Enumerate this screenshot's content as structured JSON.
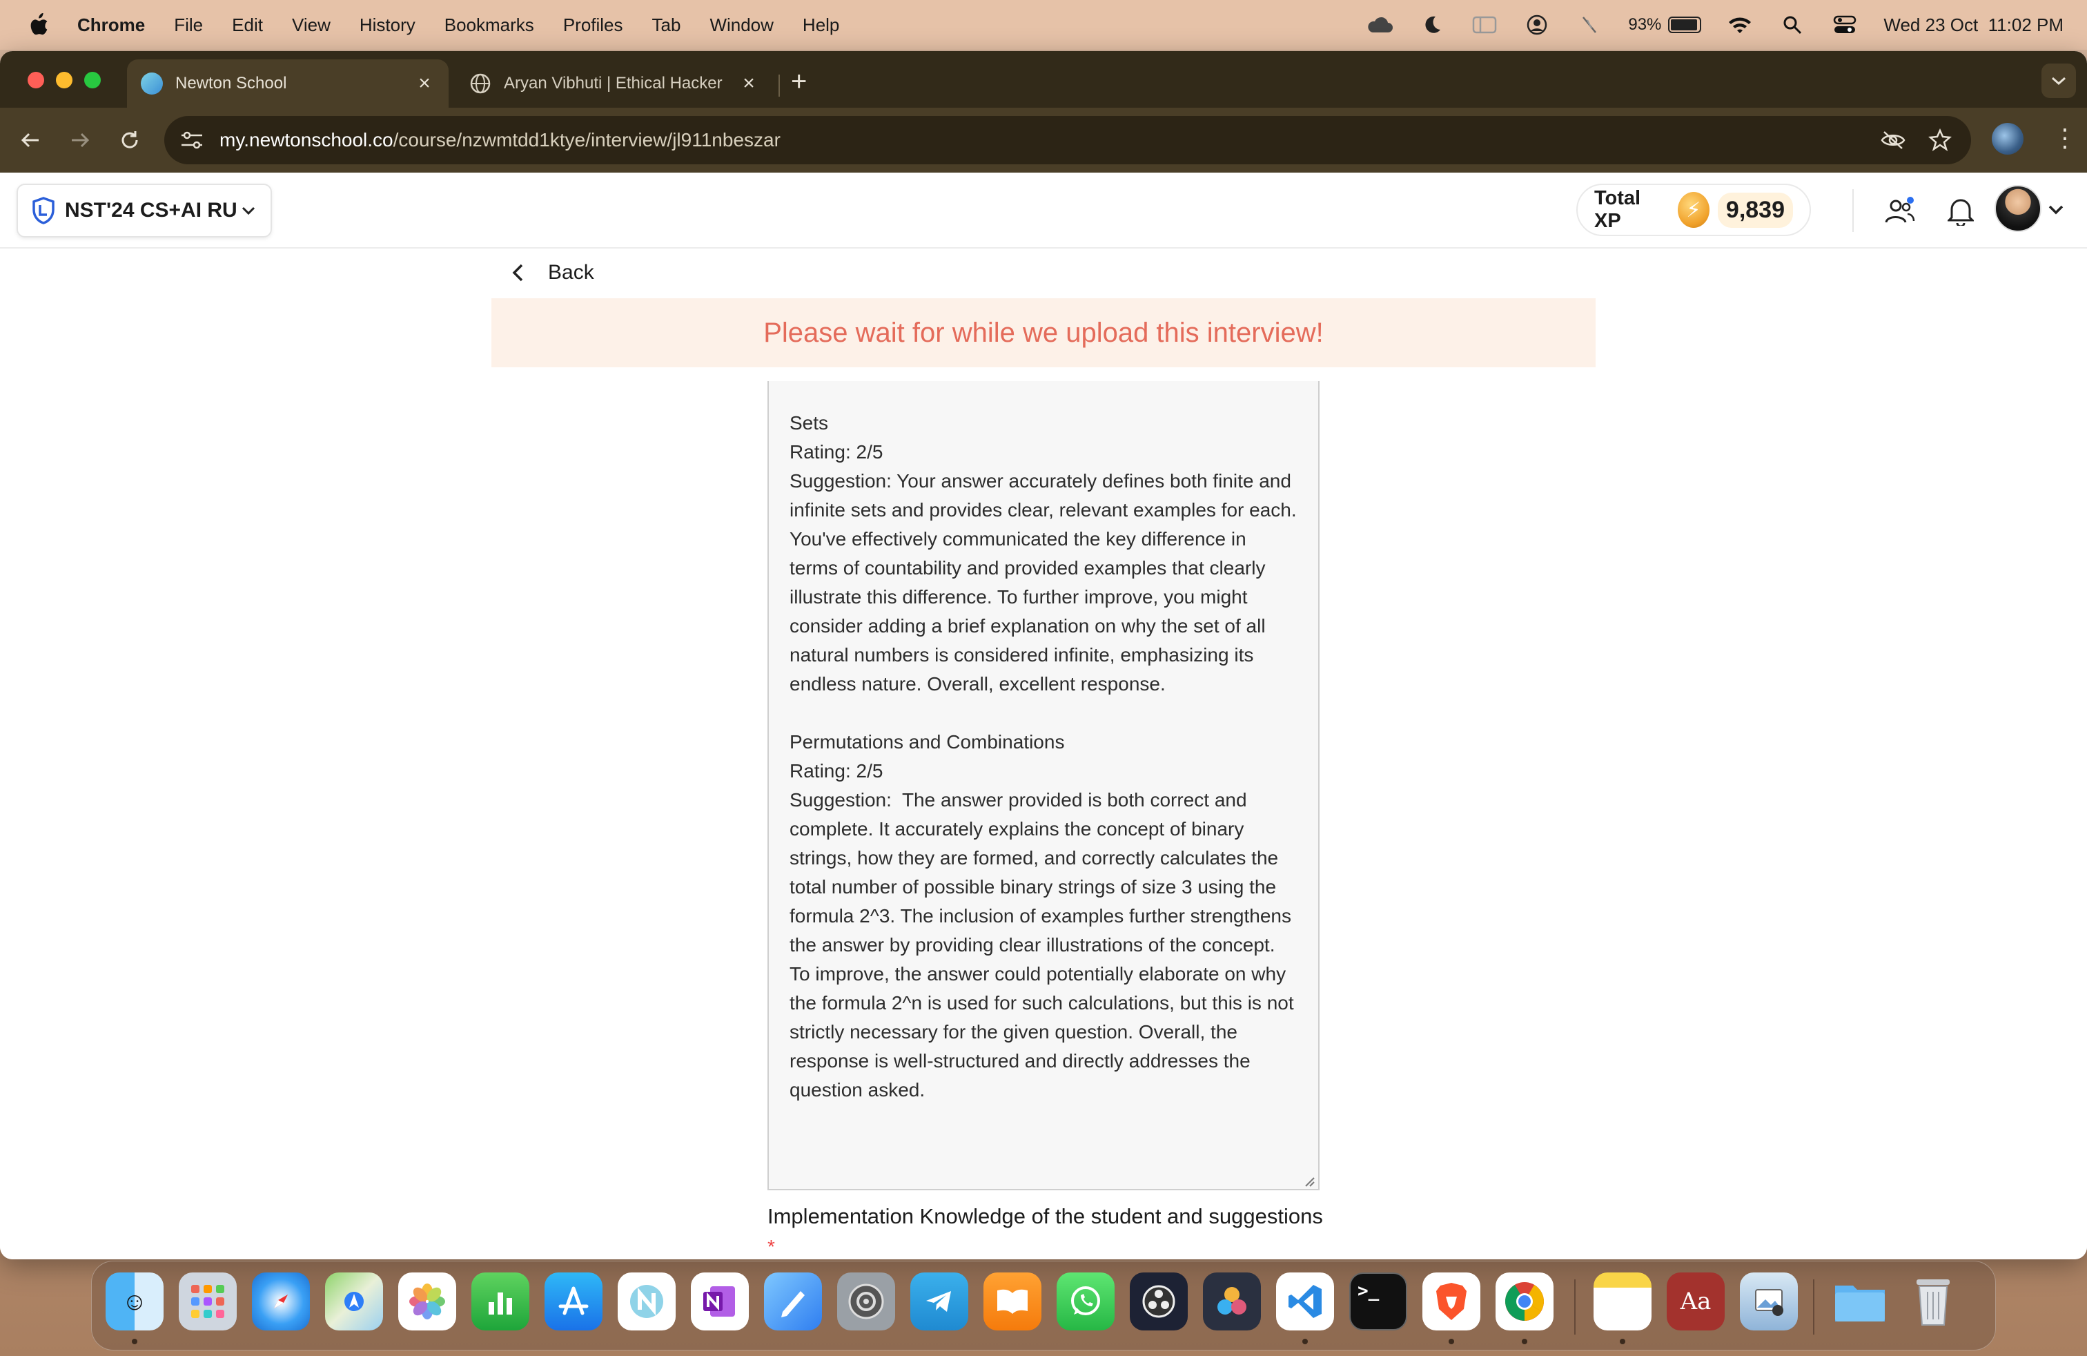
{
  "menubar": {
    "app_name": "Chrome",
    "items": [
      "File",
      "Edit",
      "View",
      "History",
      "Bookmarks",
      "Profiles",
      "Tab",
      "Window",
      "Help"
    ],
    "battery_percent": "93%",
    "datetime": "Wed 23 Oct  11:02 PM",
    "status_icons": [
      "cloud-icon",
      "moon-icon",
      "sidebar-icon",
      "user-circle-icon",
      "mic-off-icon",
      "battery-icon",
      "wifi-icon",
      "search-icon",
      "control-center-icon"
    ]
  },
  "browser": {
    "tabs": [
      {
        "title": "Newton School",
        "active": true,
        "icon": "newton-favicon"
      },
      {
        "title": "Aryan Vibhuti | Ethical Hacker",
        "active": false,
        "icon": "globe-icon"
      }
    ],
    "url_domain": "my.newtonschool.co",
    "url_path": "/course/nzwmtdd1ktye/interview/jl911nbeszar"
  },
  "header": {
    "course_name": "NST'24 CS+AI RU",
    "xp_label": "Total XP",
    "xp_value": "9,839"
  },
  "page": {
    "back_label": "Back",
    "banner_text": "Please wait for while we upload this interview!",
    "feedback_text": "Sets\nRating: 2/5\nSuggestion: Your answer accurately defines both finite and infinite sets and provides clear, relevant examples for each. You've effectively communicated the key difference in terms of countability and provided examples that clearly illustrate this difference. To further improve, you might consider adding a brief explanation on why the set of all natural numbers is considered infinite, emphasizing its endless nature. Overall, excellent response.\n\nPermutations and Combinations\nRating: 2/5\nSuggestion:  The answer provided is both correct and complete. It accurately explains the concept of binary strings, how they are formed, and correctly calculates the total number of possible binary strings of size 3 using the formula 2^3. The inclusion of examples further strengthens the answer by providing clear illustrations of the concept. To improve, the answer could potentially elaborate on why the formula 2^n is used for such calculations, but this is not strictly necessary for the given question. Overall, the response is well-structured and directly addresses the question asked.",
    "next_section_label": "Implementation Knowledge of the student and suggestions",
    "required_marker": "*"
  },
  "dock": {
    "apps": [
      "Finder",
      "Launchpad",
      "Safari",
      "Maps",
      "Photos",
      "Numbers",
      "App Store",
      "Newton",
      "OneNote",
      "Freeform",
      "System Settings",
      "Telegram",
      "Books",
      "WhatsApp",
      "OBS",
      "DaVinci Resolve",
      "VS Code",
      "Terminal",
      "Brave",
      "Chrome",
      "Notes",
      "Dictionary",
      "Preview",
      "Downloads",
      "Trash"
    ]
  },
  "colors": {
    "banner_text": "#e46b5a",
    "banner_bg": "#fdf1e8",
    "chrome_frame": "#322a19",
    "chrome_toolbar": "#4a3e27",
    "menubar": "#e6c2a8"
  }
}
